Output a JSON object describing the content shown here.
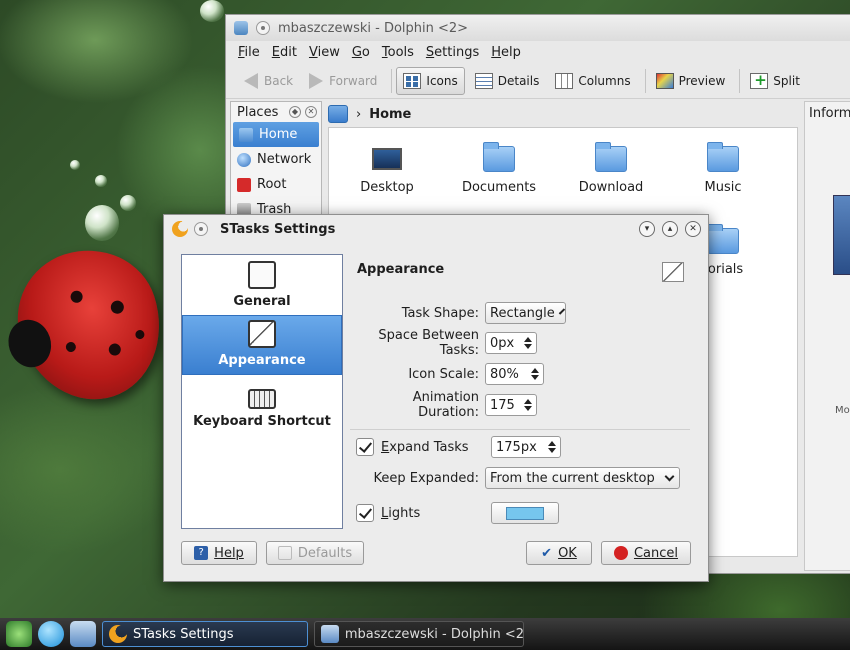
{
  "dolphin": {
    "title": "mbaszczewski - Dolphin <2>",
    "menu": [
      "File",
      "Edit",
      "View",
      "Go",
      "Tools",
      "Settings",
      "Help"
    ],
    "toolbar": {
      "back": "Back",
      "forward": "Forward",
      "icons": "Icons",
      "details": "Details",
      "columns": "Columns",
      "preview": "Preview",
      "split": "Split"
    },
    "places": {
      "title": "Places",
      "items": [
        {
          "label": "Home",
          "icon": "home-icon"
        },
        {
          "label": "Network",
          "icon": "network-icon"
        },
        {
          "label": "Root",
          "icon": "root-icon"
        },
        {
          "label": "Trash",
          "icon": "trash-icon"
        }
      ]
    },
    "breadcrumb": "Home",
    "files": [
      "Desktop",
      "Documents",
      "Download",
      "Music"
    ],
    "partial_file_label": "torials",
    "info_panel_title": "Informa",
    "info_panel_partial": "Mo"
  },
  "dialog": {
    "title": "STasks Settings",
    "sidebar": [
      {
        "label": "General",
        "icon": "document-icon"
      },
      {
        "label": "Appearance",
        "icon": "appearance-icon"
      },
      {
        "label": "Keyboard Shortcut",
        "icon": "keyboard-icon"
      }
    ],
    "section_title": "Appearance",
    "fields": {
      "task_shape_label": "Task Shape:",
      "task_shape_value": "Rectangle",
      "space_label": "Space Between Tasks:",
      "space_value": "0px",
      "icon_scale_label": "Icon Scale:",
      "icon_scale_value": "80%",
      "animation_label": "Animation Duration:",
      "animation_value": "175",
      "expand_tasks_label": "Expand Tasks",
      "expand_tasks_checked": true,
      "expand_tasks_value": "175px",
      "keep_expanded_label": "Keep Expanded:",
      "keep_expanded_value": "From the current desktop",
      "lights_label": "Lights",
      "lights_checked": true,
      "lights_color": "#76c6ee"
    },
    "buttons": {
      "help": "Help",
      "defaults": "Defaults",
      "ok": "OK",
      "cancel": "Cancel"
    }
  },
  "taskbar": {
    "tasks": [
      {
        "label": "STasks Settings",
        "active": true
      },
      {
        "label": "mbaszczewski - Dolphin <2",
        "active": false
      }
    ]
  }
}
